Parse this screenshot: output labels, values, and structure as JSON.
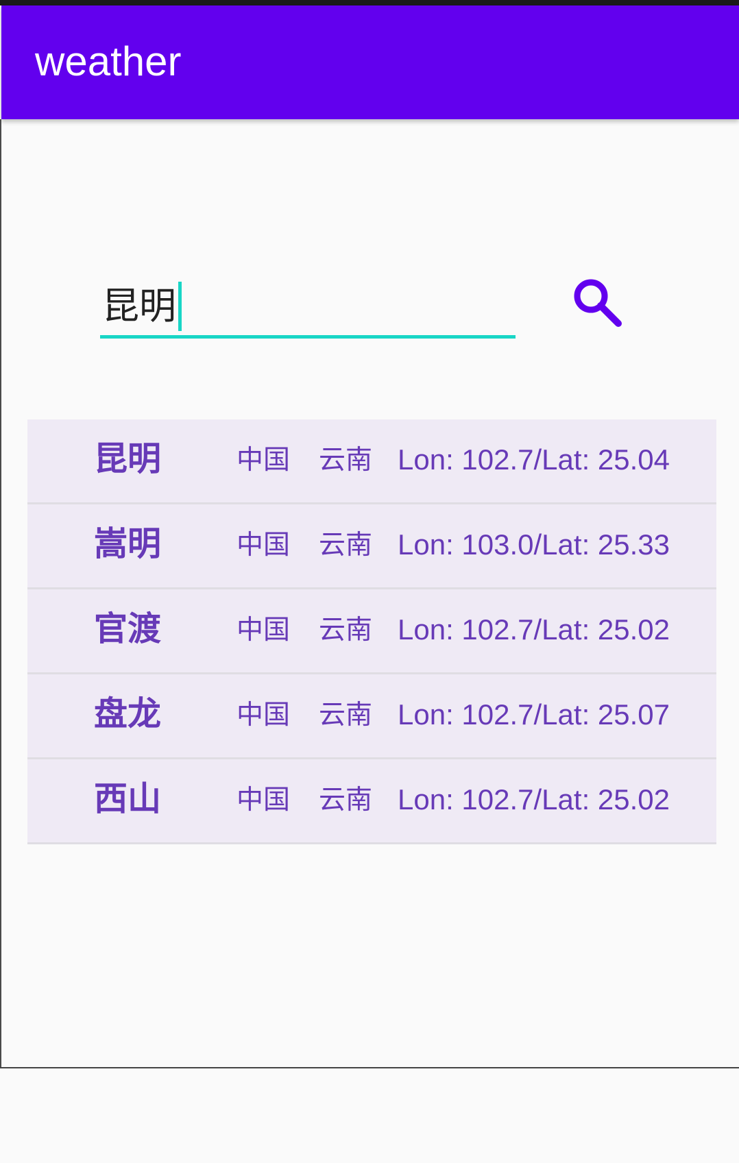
{
  "app_bar": {
    "title": "weather",
    "background": "#6200ee"
  },
  "search": {
    "value": "昆明",
    "accent": "#18d6c6",
    "button_icon": "search-icon",
    "icon_color": "#6200ee"
  },
  "results": [
    {
      "city": "昆明",
      "country": "中国",
      "province": "云南",
      "coords": "Lon: 102.7/Lat: 25.04"
    },
    {
      "city": "嵩明",
      "country": "中国",
      "province": "云南",
      "coords": "Lon: 103.0/Lat: 25.33"
    },
    {
      "city": "官渡",
      "country": "中国",
      "province": "云南",
      "coords": "Lon: 102.7/Lat: 25.02"
    },
    {
      "city": "盘龙",
      "country": "中国",
      "province": "云南",
      "coords": "Lon: 102.7/Lat: 25.07"
    },
    {
      "city": "西山",
      "country": "中国",
      "province": "云南",
      "coords": "Lon: 102.7/Lat: 25.02"
    }
  ],
  "colors": {
    "row_background": "#efeaf5",
    "row_text": "#673ab7",
    "divider": "#dfdde3"
  }
}
